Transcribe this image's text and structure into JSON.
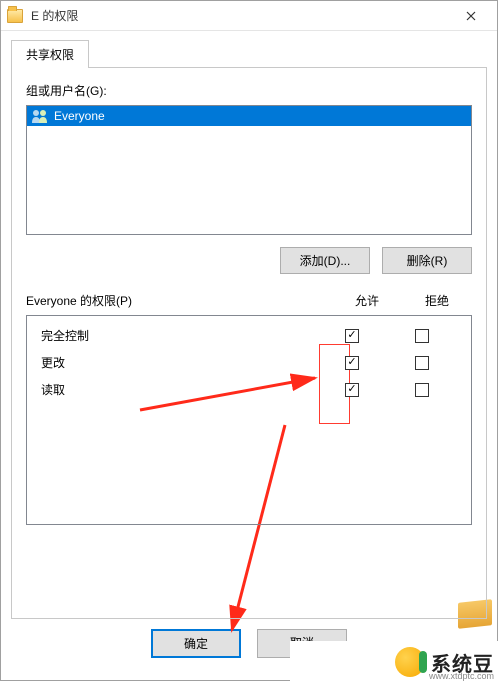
{
  "title": "E 的权限",
  "tabs": [
    {
      "label": "共享权限"
    }
  ],
  "groups_label": "组或用户名(G):",
  "groups": [
    {
      "name": "Everyone"
    }
  ],
  "buttons": {
    "add": "添加(D)...",
    "remove": "删除(R)",
    "ok": "确定",
    "cancel": "取消"
  },
  "perm_label": "Everyone 的权限(P)",
  "columns": {
    "allow": "允许",
    "deny": "拒绝"
  },
  "permissions": [
    {
      "name": "完全控制",
      "allow": true,
      "deny": false
    },
    {
      "name": "更改",
      "allow": true,
      "deny": false
    },
    {
      "name": "读取",
      "allow": true,
      "deny": false
    }
  ],
  "watermark": {
    "brand": "系统豆",
    "url": "www.xtdptc.com"
  }
}
